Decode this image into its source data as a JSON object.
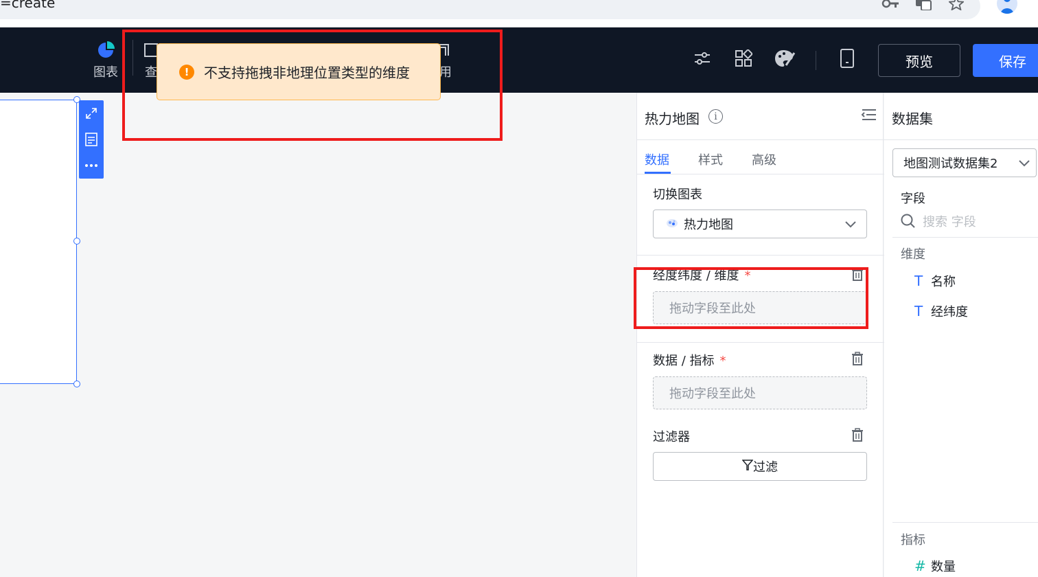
{
  "browser": {
    "url_fragment": "=create",
    "icons": [
      "key-icon",
      "translate-icon",
      "star-icon",
      "profile-avatar"
    ]
  },
  "toolbar": {
    "tools": [
      {
        "name": "chart",
        "label": "图表",
        "icon": "pie-chart-icon"
      },
      {
        "name": "query",
        "label": "查",
        "icon": "query-icon"
      },
      {
        "name": "other",
        "label": "用",
        "icon": "component-icon"
      }
    ],
    "right_icons": [
      "filter-settings-icon",
      "layout-grid-icon",
      "theme-palette-icon",
      "mobile-icon"
    ],
    "preview_label": "预览",
    "save_label": "保存",
    "colors": {
      "bg": "#0f1725",
      "primary": "#3370ff"
    }
  },
  "toast": {
    "type": "warning",
    "message": "不支持拖拽非地理位置类型的维度"
  },
  "config": {
    "title": "热力地图",
    "tabs": [
      {
        "label": "数据",
        "active": true
      },
      {
        "label": "样式",
        "active": false
      },
      {
        "label": "高级",
        "active": false
      }
    ],
    "switch_chart": {
      "label": "切换图表",
      "value": "热力地图"
    },
    "geo_dimension": {
      "label": "经度纬度 / 维度",
      "required_mark": "*",
      "placeholder": "拖动字段至此处"
    },
    "metric": {
      "label": "数据 / 指标",
      "required_mark": "*",
      "placeholder": "拖动字段至此处"
    },
    "filter": {
      "label": "过滤器",
      "button": "过滤"
    }
  },
  "dataset": {
    "title": "数据集",
    "selected": "地图测试数据集2",
    "fields_label": "字段",
    "search_placeholder": "搜索 字段",
    "dimensions_label": "维度",
    "dimensions": [
      {
        "type": "T",
        "name": "名称"
      },
      {
        "type": "T",
        "name": "经纬度"
      }
    ],
    "metrics_label": "指标",
    "metrics": [
      {
        "type": "#",
        "name": "数量"
      }
    ]
  }
}
